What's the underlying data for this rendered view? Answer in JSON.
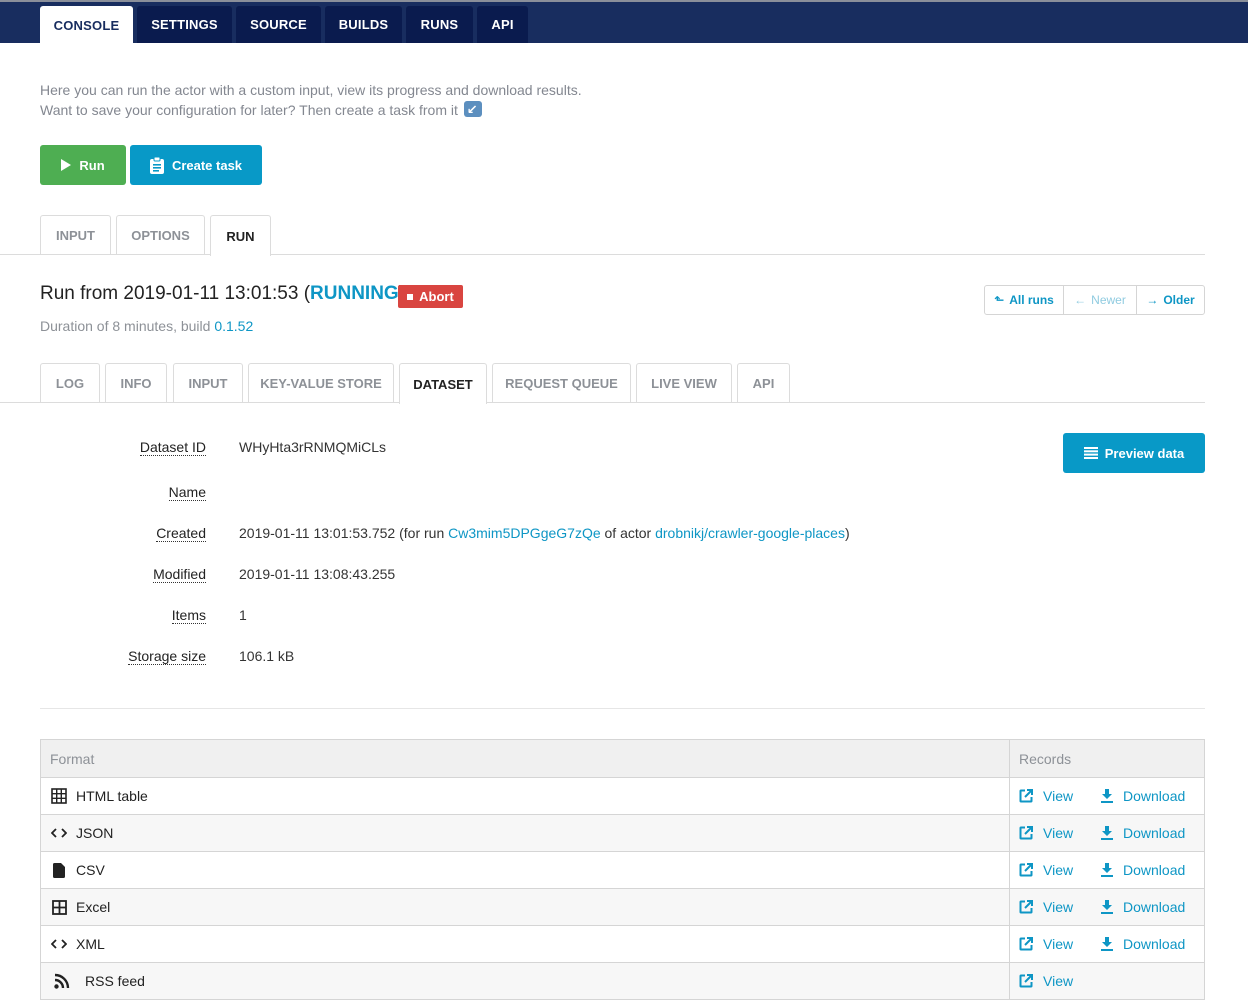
{
  "top_nav": {
    "tabs": [
      {
        "label": "CONSOLE",
        "active": true
      },
      {
        "label": "SETTINGS",
        "active": false
      },
      {
        "label": "SOURCE",
        "active": false
      },
      {
        "label": "BUILDS",
        "active": false
      },
      {
        "label": "RUNS",
        "active": false
      },
      {
        "label": "API",
        "active": false
      }
    ]
  },
  "intro": {
    "line1": "Here you can run the actor with a custom input, view its progress and download results.",
    "line2": "Want to save your configuration for later? Then create a task from it",
    "line2_icon": "arrow-down-left-icon"
  },
  "actions": {
    "run_label": "Run",
    "run_icon": "play-icon",
    "create_task_label": "Create task",
    "create_task_icon": "clipboard-icon"
  },
  "console_tabs": [
    {
      "label": "INPUT",
      "active": false
    },
    {
      "label": "OPTIONS",
      "active": false
    },
    {
      "label": "RUN",
      "active": true
    }
  ],
  "run": {
    "title_prefix": "Run from 2019-01-11 13:01:53 (",
    "status": "RUNNING",
    "title_suffix": ")",
    "abort_label": "Abort",
    "duration_text": "Duration of 8 minutes, build ",
    "build": "0.1.52",
    "pager": {
      "all_runs": "All runs",
      "newer": "Newer",
      "older": "Older"
    }
  },
  "run_tabs": [
    {
      "label": "LOG",
      "active": false
    },
    {
      "label": "INFO",
      "active": false
    },
    {
      "label": "INPUT",
      "active": false
    },
    {
      "label": "KEY-VALUE STORE",
      "active": false
    },
    {
      "label": "DATASET",
      "active": true
    },
    {
      "label": "REQUEST QUEUE",
      "active": false
    },
    {
      "label": "LIVE VIEW",
      "active": false
    },
    {
      "label": "API",
      "active": false
    }
  ],
  "dataset": {
    "preview_label": "Preview data",
    "labels": {
      "id": "Dataset ID",
      "name": "Name",
      "created": "Created",
      "modified": "Modified",
      "items": "Items",
      "storage_size": "Storage size"
    },
    "id": "WHyHta3rRNMQMiCLs",
    "name": "",
    "created": {
      "timestamp": "2019-01-11 13:01:53.752",
      "pre_run": " (for run ",
      "run_id": "Cw3mim5DPGgeG7zQe",
      "pre_actor": " of actor ",
      "actor": "drobnikj/crawler-google-places",
      "close": ")"
    },
    "modified": "2019-01-11 13:08:43.255",
    "items": "1",
    "storage_size": "106.1 kB"
  },
  "formats": {
    "header_format": "Format",
    "header_records": "Records",
    "view_label": "View",
    "download_label": "Download",
    "rows": [
      {
        "name": "HTML table",
        "icon": "table-icon",
        "download": true
      },
      {
        "name": "JSON",
        "icon": "code-icon",
        "download": true
      },
      {
        "name": "CSV",
        "icon": "file-icon",
        "download": true
      },
      {
        "name": "Excel",
        "icon": "grid-icon",
        "download": true
      },
      {
        "name": "XML",
        "icon": "code-icon",
        "download": true
      },
      {
        "name": "RSS feed",
        "icon": "rss-icon",
        "download": false
      }
    ]
  }
}
